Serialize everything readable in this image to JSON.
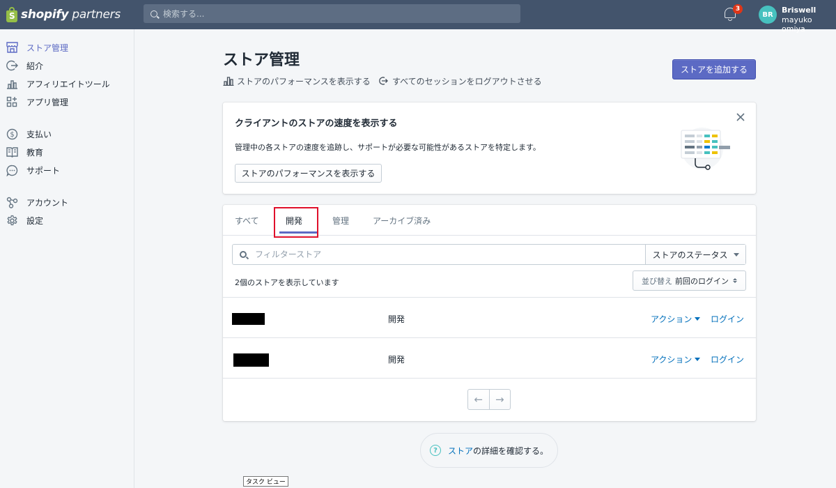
{
  "topbar": {
    "logo_bold": "shopify",
    "logo_light": "partners",
    "search_placeholder": "検索する...",
    "notification_count": "3",
    "avatar_initials": "BR",
    "user_name": "Briswell",
    "user_sub": "mayuko omiya"
  },
  "sidebar": {
    "items": [
      {
        "label": "ストア管理",
        "icon": "store-icon",
        "active": true
      },
      {
        "label": "紹介",
        "icon": "referral-icon"
      },
      {
        "label": "アフィリエイトツール",
        "icon": "chart-bars-icon"
      },
      {
        "label": "アプリ管理",
        "icon": "apps-icon"
      },
      {
        "label": "支払い",
        "icon": "dollar-icon"
      },
      {
        "label": "教育",
        "icon": "book-icon"
      },
      {
        "label": "サポート",
        "icon": "chat-icon"
      },
      {
        "label": "アカウント",
        "icon": "account-icon"
      },
      {
        "label": "設定",
        "icon": "gear-icon"
      }
    ]
  },
  "header": {
    "title": "ストア管理",
    "action_performance": "ストアのパフォーマンスを表示する",
    "action_logout": "すべてのセッションをログアウトさせる",
    "add_store": "ストアを追加する"
  },
  "promo": {
    "title": "クライアントのストアの速度を表示する",
    "description": "管理中の各ストアの速度を追跡し、サポートが必要な可能性があるストアを特定します。",
    "button": "ストアのパフォーマンスを表示する"
  },
  "tabs": [
    {
      "label": "すべて"
    },
    {
      "label": "開発",
      "active": true
    },
    {
      "label": "管理"
    },
    {
      "label": "アーカイブ済み"
    }
  ],
  "filter": {
    "placeholder": "フィルターストア",
    "status_label": "ストアのステータス"
  },
  "list": {
    "count_text": "2個のストアを表示しています",
    "sort_label": "並び替え",
    "sort_value": "前回のログイン",
    "rows": [
      {
        "type": "開発",
        "action": "アクション",
        "login": "ログイン"
      },
      {
        "type": "開発",
        "action": "アクション",
        "login": "ログイン"
      }
    ]
  },
  "pager": {
    "prev": "←",
    "next": "→"
  },
  "footer": {
    "link": "ストア",
    "rest": "の詳細を確認する。"
  },
  "taskbar_tooltip": "タスク ビュー",
  "colors": {
    "topbar": "#43546c",
    "accent": "#5c6ac4",
    "link": "#006fbb",
    "highlight": "#e0102b"
  }
}
